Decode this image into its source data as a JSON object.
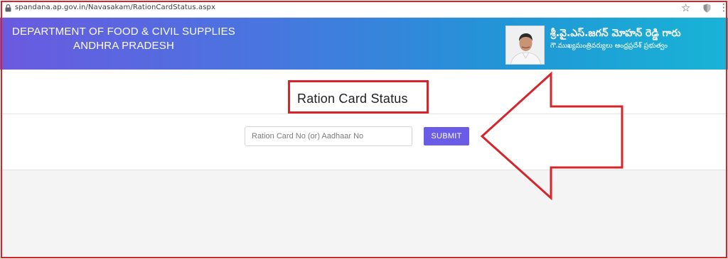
{
  "browser": {
    "url": "spandana.ap.gov.in/Navasakam/RationCardStatus.aspx"
  },
  "header": {
    "dept_line1": "DEPARTMENT OF FOOD & CIVIL SUPPLIES",
    "dept_line2": "ANDHRA PRADESH",
    "cm_name": "శ్రీ.వై.ఎస్.జగన్ మోహన్ రెడ్డి గారు",
    "cm_title": "గౌ.ముఖ్యమంత్రివర్యులు ఆంధ్రప్రదేశ్ ప్రభుత్వం"
  },
  "main": {
    "title": "Ration Card Status",
    "input_placeholder": "Ration Card No (or) Aadhaar No",
    "input_value": "",
    "submit_label": "SUBMIT"
  },
  "icons": {
    "lock": "lock-icon",
    "star": "star-icon",
    "shield": "shield-icon",
    "menu": "menu-icon",
    "annotation_arrow": "arrow-left-icon"
  },
  "colors": {
    "banner_start": "#6a5ae0",
    "banner_end": "#18b4d6",
    "submit": "#6b5ce7",
    "annotation_red": "#d6242a"
  }
}
